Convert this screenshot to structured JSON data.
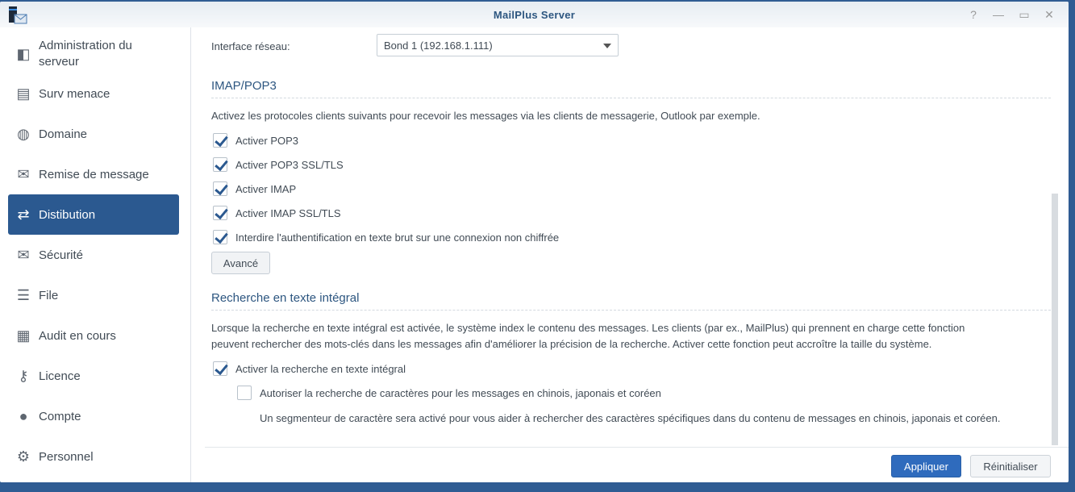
{
  "window": {
    "title": "MailPlus Server"
  },
  "controls": {
    "help": "?",
    "minimize": "—",
    "maximize": "▭",
    "close": "✕"
  },
  "sidebar": {
    "items": [
      {
        "label": "Administration du serveur",
        "icon": "server-admin-icon"
      },
      {
        "label": "Surv menace",
        "icon": "id-card-icon"
      },
      {
        "label": "Domaine",
        "icon": "globe-icon"
      },
      {
        "label": "Remise de message",
        "icon": "mail-upload-icon"
      },
      {
        "label": "Distibution",
        "icon": "arrows-exchange-icon",
        "active": true
      },
      {
        "label": "Sécurité",
        "icon": "mail-security-icon"
      },
      {
        "label": "File",
        "icon": "list-icon"
      },
      {
        "label": "Audit en cours",
        "icon": "audit-icon"
      },
      {
        "label": "Licence",
        "icon": "key-icon"
      },
      {
        "label": "Compte",
        "icon": "user-icon"
      },
      {
        "label": "Personnel",
        "icon": "gear-icon"
      }
    ]
  },
  "main": {
    "interface_label": "Interface réseau:",
    "interface_value": "Bond 1 (192.168.1.111)",
    "imap_title": "IMAP/POP3",
    "imap_desc": "Activez les protocoles clients suivants pour recevoir les messages via les clients de messagerie, Outlook par exemple.",
    "imap_options": [
      {
        "label": "Activer POP3",
        "checked": true
      },
      {
        "label": "Activer POP3 SSL/TLS",
        "checked": true
      },
      {
        "label": "Activer IMAP",
        "checked": true
      },
      {
        "label": "Activer IMAP SSL/TLS",
        "checked": true
      },
      {
        "label": "Interdire l'authentification en texte brut sur une connexion non chiffrée",
        "checked": true
      }
    ],
    "advanced_label": "Avancé",
    "fts_title": "Recherche en texte intégral",
    "fts_desc1": "Lorsque la recherche en texte intégral est activée, le système index le contenu des messages. Les clients (par ex., MailPlus) qui prennent en charge cette fonction",
    "fts_desc2": "peuvent rechercher des mots-clés dans les messages afin d'améliorer la précision de la recherche. Activer cette fonction peut accroître la taille du système.",
    "fts_enable": {
      "label": "Activer la recherche en texte intégral",
      "checked": true
    },
    "fts_cjk": {
      "label": "Autoriser la recherche de caractères pour les messages en chinois, japonais et coréen",
      "checked": false
    },
    "fts_cjk_note": "Un segmenteur de caractère sera activé pour vous aider à rechercher des caractères spécifiques dans du contenu de messages en chinois, japonais et coréen."
  },
  "footer": {
    "apply": "Appliquer",
    "reset": "Réinitialiser"
  }
}
